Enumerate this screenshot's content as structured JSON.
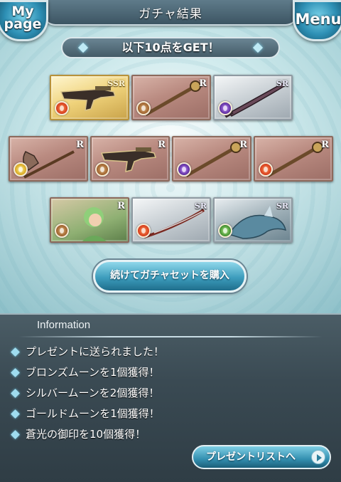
{
  "header": {
    "title": "ガチャ結果",
    "mypage_label": "My\npage",
    "menu_label": "Menu"
  },
  "banner": {
    "text": "以下10点をGET！"
  },
  "cards": [
    {
      "rarity": "SSR",
      "element": "fire",
      "kind": "weapon-gun"
    },
    {
      "rarity": "R",
      "element": "earth",
      "kind": "weapon-staff"
    },
    {
      "rarity": "SR",
      "element": "dark",
      "kind": "weapon-blade"
    },
    {
      "rarity": "R",
      "element": "light",
      "kind": "weapon-axe"
    },
    {
      "rarity": "R",
      "element": "earth",
      "kind": "weapon-gun"
    },
    {
      "rarity": "R",
      "element": "dark",
      "kind": "weapon-staff"
    },
    {
      "rarity": "R",
      "element": "fire",
      "kind": "weapon-staff"
    },
    {
      "rarity": "R",
      "element": "earth",
      "kind": "summon-girl"
    },
    {
      "rarity": "SR",
      "element": "fire",
      "kind": "weapon-katana"
    },
    {
      "rarity": "SR",
      "element": "wind",
      "kind": "summon-dragon"
    }
  ],
  "buy_button": {
    "label": "続けてガチャセットを購入"
  },
  "info": {
    "heading": "Information",
    "items": [
      "プレゼントに送られました！",
      "ブロンズムーンを1個獲得！",
      "シルバームーンを2個獲得！",
      "ゴールドムーンを1個獲得！",
      "蒼光の御印を10個獲得！"
    ],
    "present_button": "プレゼントリストへ"
  },
  "colors": {
    "accent": "#3d9dbd",
    "panel": "#3a4a53"
  }
}
